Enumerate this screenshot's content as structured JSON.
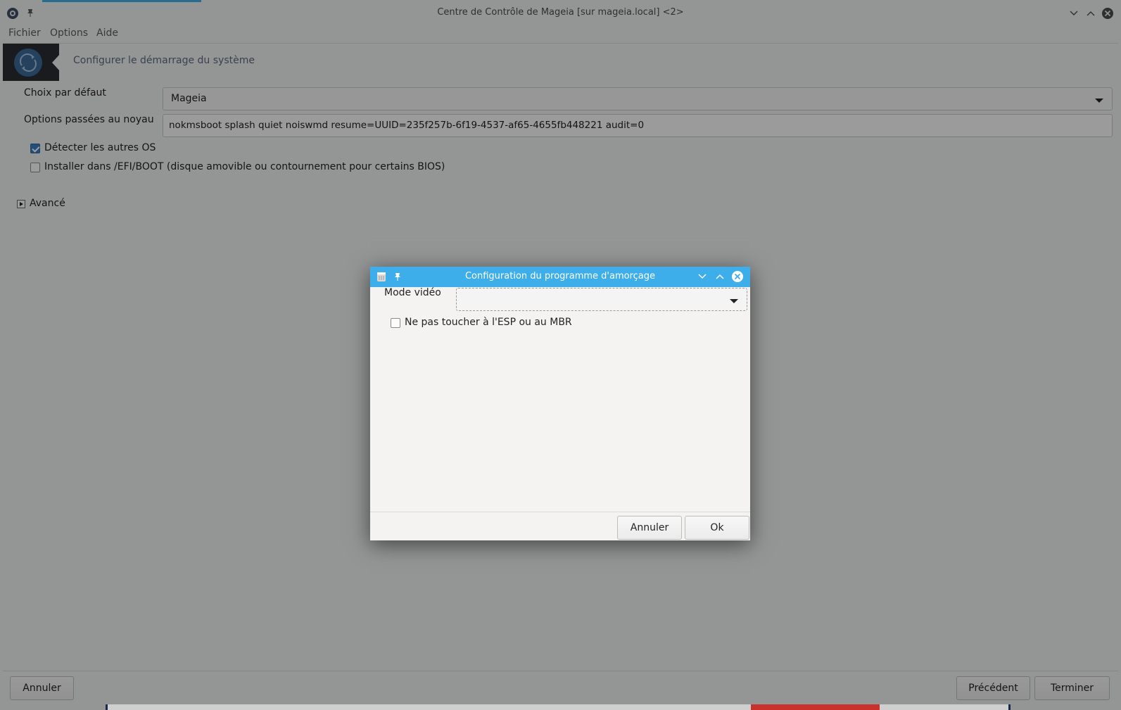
{
  "window": {
    "title": "Centre de Contrôle de Mageia [sur mageia.local] <2>"
  },
  "menubar": {
    "items": [
      "Fichier",
      "Options",
      "Aide"
    ]
  },
  "header": {
    "title": "Configurer le démarrage du système"
  },
  "form": {
    "default_choice_label": "Choix par défaut",
    "default_choice_value": "Mageia",
    "kernel_options_label": "Options passées au noyau",
    "kernel_options_value": "nokmsboot splash quiet noiswmd resume=UUID=235f257b-6f19-4537-af65-4655fb448221 audit=0",
    "detect_other_os_label": "Détecter les autres OS",
    "detect_other_os_checked": true,
    "install_efi_label": "Installer dans /EFI/BOOT (disque amovible ou contournement pour certains BIOS)",
    "install_efi_checked": false,
    "advanced_label": "Avancé"
  },
  "footer": {
    "cancel_label": "Annuler",
    "previous_label": "Précédent",
    "finish_label": "Terminer"
  },
  "dialog": {
    "title": "Configuration du programme d'amorçage",
    "video_mode_label": "Mode vidéo",
    "video_mode_value": "",
    "no_touch_esp_label": "Ne pas toucher à l'ESP ou au MBR",
    "no_touch_esp_checked": false,
    "cancel_label": "Annuler",
    "ok_label": "Ok"
  },
  "colors": {
    "accent": "#3daee9",
    "checkbox_checked": "#3b7cc1",
    "banner_icon_bg": "#2b2d33"
  }
}
